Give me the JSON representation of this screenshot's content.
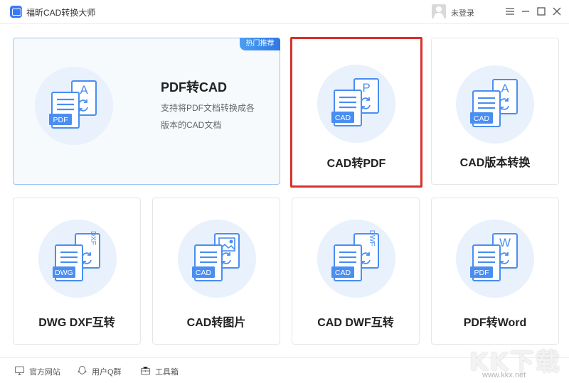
{
  "window": {
    "title": "福昕CAD转换大师",
    "login_label": "未登录"
  },
  "colors": {
    "accent": "#3a7bf5",
    "icon_bg": "#e8f1fc",
    "doc_blue": "#4a8ef2",
    "selected_border": "#d8312b"
  },
  "hot_card": {
    "badge": "热门推荐",
    "title": "PDF转CAD",
    "desc_line1": "支持将PDF文档转换成各",
    "desc_line2": "版本的CAD文档",
    "front_tag": "PDF",
    "back_letter": "A"
  },
  "cards": [
    {
      "label": "CAD转PDF",
      "front_tag": "CAD",
      "back_letter": "P",
      "selected": true
    },
    {
      "label": "CAD版本转换",
      "front_tag": "CAD",
      "back_letter": "A",
      "selected": false
    },
    {
      "label": "DWG DXF互转",
      "front_tag": "DWG",
      "back_letter": "DXF",
      "selected": false
    },
    {
      "label": "CAD转图片",
      "front_tag": "CAD",
      "back_letter": "image",
      "selected": false
    },
    {
      "label": "CAD DWF互转",
      "front_tag": "CAD",
      "back_letter": "DWF",
      "selected": false
    },
    {
      "label": "PDF转Word",
      "front_tag": "PDF",
      "back_letter": "W",
      "selected": false
    }
  ],
  "footer": {
    "website": "官方网站",
    "qq_group": "用户Q群",
    "toolbox": "工具箱"
  },
  "watermark": {
    "big": "KK下载",
    "small": "www.kkx.net"
  }
}
